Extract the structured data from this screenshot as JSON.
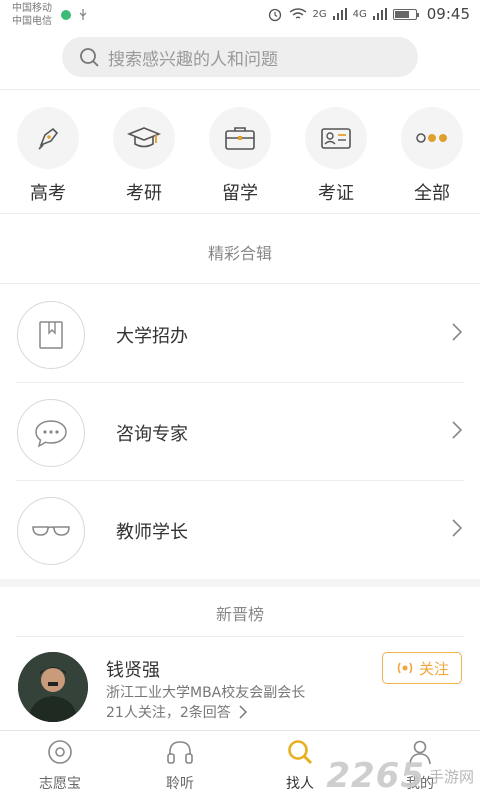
{
  "status_bar": {
    "carrier_1": "中国移动",
    "carrier_2": "中国电信",
    "network_1": "2G",
    "network_2": "4G",
    "time": "09:45",
    "battery_level": 0.7
  },
  "search": {
    "placeholder": "搜索感兴趣的人和问题",
    "icon": "search-icon"
  },
  "categories": [
    {
      "label": "高考",
      "icon": "pen-nib-icon"
    },
    {
      "label": "考研",
      "icon": "graduation-cap-icon"
    },
    {
      "label": "留学",
      "icon": "briefcase-icon"
    },
    {
      "label": "考证",
      "icon": "id-card-icon"
    },
    {
      "label": "全部",
      "icon": "more-dots-icon"
    }
  ],
  "featured": {
    "title": "精彩合辑",
    "items": [
      {
        "label": "大学招办",
        "icon": "book-icon"
      },
      {
        "label": "咨询专家",
        "icon": "chat-bubble-icon"
      },
      {
        "label": "教师学长",
        "icon": "glasses-icon"
      }
    ]
  },
  "newcomers": {
    "title": "新晋榜",
    "user": {
      "name": "钱贤强",
      "description": "浙江工业大学MBA校友会副会长",
      "stats": "21人关注，2条回答",
      "follow_label": "关注"
    }
  },
  "bottom_nav": [
    {
      "label": "志愿宝",
      "icon": "target-icon",
      "active": false
    },
    {
      "label": "聆听",
      "icon": "headphones-icon",
      "active": false
    },
    {
      "label": "找人",
      "icon": "search-person-icon",
      "active": true
    },
    {
      "label": "我的",
      "icon": "person-icon",
      "active": false
    }
  ],
  "watermark": {
    "number": "2265",
    "text": "手游网"
  },
  "colors": {
    "accent": "#f0a63a",
    "active_nav": "#e8b020"
  }
}
